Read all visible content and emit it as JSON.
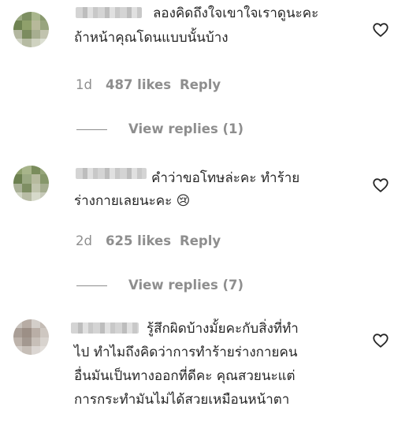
{
  "comments": [
    {
      "text_lines": [
        "ลองคิดถึงใจเขาใจเราดูนะคะ",
        "ถ้าหน้าคุณโดนแบบนั้นบ้าง"
      ],
      "age": "1d",
      "likes": "487 likes",
      "reply_label": "Reply",
      "view_replies": "View replies (1)"
    },
    {
      "text_lines": [
        "คำว่าขอโทษล่ะคะ ทำร้าย",
        "ร่างกายเลยนะคะ 😢"
      ],
      "age": "2d",
      "likes": "625 likes",
      "reply_label": "Reply",
      "view_replies": "View replies (7)"
    },
    {
      "text_lines": [
        "รู้สึกผิดบ้างมั้ยคะกับสิ่งที่ทำ",
        "ไป ทำไมถึงคิดว่าการทำร้ายร่างกายคน",
        "อื่นมันเป็นทางออกที่ดีคะ คุณสวยนะแต่",
        "การกระทำมันไม่ได้สวยเหมือนหน้าตา"
      ]
    }
  ],
  "colors": {
    "text": "#262626",
    "secondary": "#8e8e8e",
    "background": "#ffffff"
  },
  "icons": {
    "like": "heart-outline-icon"
  }
}
